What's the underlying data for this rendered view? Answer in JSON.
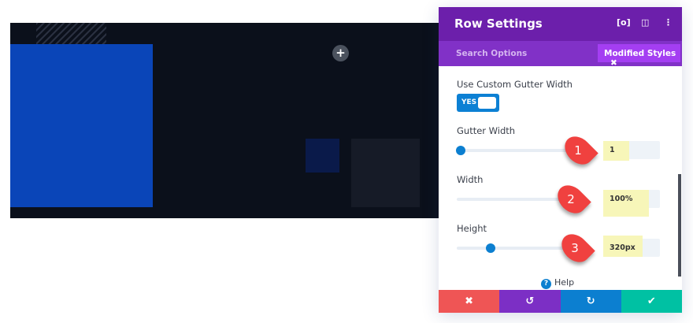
{
  "canvas": {
    "add_icon": "plus-icon"
  },
  "panel": {
    "title": "Row Settings",
    "header_icons": [
      "focus-icon",
      "split-view-icon",
      "more-icon"
    ],
    "search_label": "Search Options",
    "modified_styles_label": "Modified Styles",
    "modified_close": "✖",
    "custom_gutter_label": "Use Custom Gutter Width",
    "toggle_label": "YES",
    "gutter_label": "Gutter Width",
    "gutter_value": "1",
    "width_label": "Width",
    "width_value": "100%",
    "height_label": "Height",
    "height_value": "320px",
    "help_label": "Help",
    "annotations": [
      "1",
      "2",
      "3"
    ],
    "colors": {
      "header": "#6c1fab",
      "cancel": "#ef5555",
      "undo": "#7c2fc5",
      "redo": "#0c7fd0",
      "save": "#00c1a3"
    }
  },
  "footer": {
    "cancel": "✖",
    "undo": "↺",
    "redo": "↻",
    "save": "✔"
  }
}
